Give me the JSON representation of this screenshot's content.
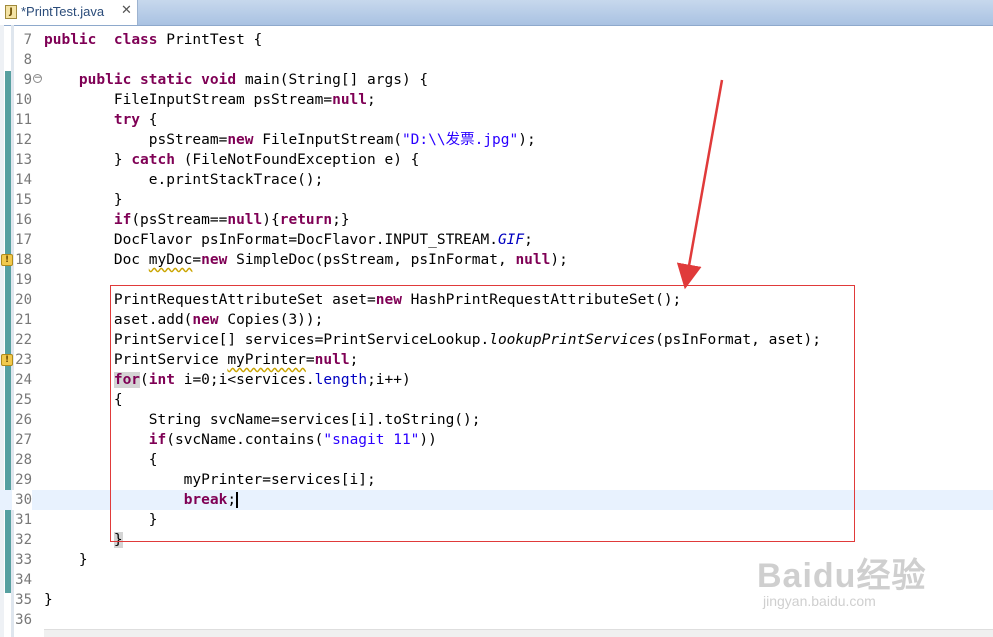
{
  "tab": {
    "title": "*PrintTest.java",
    "close": "✕",
    "icon_letter": "J"
  },
  "lines": [
    {
      "num": "7",
      "current": false,
      "fold": false,
      "warning": false,
      "segs": [
        [
          "kw",
          "public"
        ],
        [
          "",
          "  "
        ],
        [
          "kw",
          "class"
        ],
        [
          "",
          " PrintTest {"
        ]
      ]
    },
    {
      "num": "8",
      "current": false,
      "fold": false,
      "warning": false,
      "segs": []
    },
    {
      "num": "9",
      "current": false,
      "fold": true,
      "warning": false,
      "segs": [
        [
          "",
          "    "
        ],
        [
          "kw",
          "public"
        ],
        [
          "",
          " "
        ],
        [
          "kw",
          "static"
        ],
        [
          "",
          " "
        ],
        [
          "kw",
          "void"
        ],
        [
          "",
          " main(String[] args) {"
        ]
      ]
    },
    {
      "num": "10",
      "current": false,
      "fold": false,
      "warning": false,
      "segs": [
        [
          "",
          "        FileInputStream psStream="
        ],
        [
          "kw",
          "null"
        ],
        [
          "",
          ";"
        ]
      ]
    },
    {
      "num": "11",
      "current": false,
      "fold": false,
      "warning": false,
      "segs": [
        [
          "",
          "        "
        ],
        [
          "kw",
          "try"
        ],
        [
          "",
          " {"
        ]
      ]
    },
    {
      "num": "12",
      "current": false,
      "fold": false,
      "warning": false,
      "segs": [
        [
          "",
          "            psStream="
        ],
        [
          "kw",
          "new"
        ],
        [
          "",
          " FileInputStream("
        ],
        [
          "str",
          "\"D:\\\\发票.jpg\""
        ],
        [
          "",
          ");"
        ]
      ]
    },
    {
      "num": "13",
      "current": false,
      "fold": false,
      "warning": false,
      "segs": [
        [
          "",
          "        } "
        ],
        [
          "kw",
          "catch"
        ],
        [
          "",
          " (FileNotFoundException e) {"
        ]
      ]
    },
    {
      "num": "14",
      "current": false,
      "fold": false,
      "warning": false,
      "segs": [
        [
          "",
          "            e.printStackTrace();"
        ]
      ]
    },
    {
      "num": "15",
      "current": false,
      "fold": false,
      "warning": false,
      "segs": [
        [
          "",
          "        }"
        ]
      ]
    },
    {
      "num": "16",
      "current": false,
      "fold": false,
      "warning": false,
      "segs": [
        [
          "",
          "        "
        ],
        [
          "kw",
          "if"
        ],
        [
          "",
          "(psStream=="
        ],
        [
          "kw",
          "null"
        ],
        [
          "",
          "){"
        ],
        [
          "kw",
          "return"
        ],
        [
          "",
          ";}"
        ]
      ]
    },
    {
      "num": "17",
      "current": false,
      "fold": false,
      "warning": false,
      "segs": [
        [
          "",
          "        DocFlavor psInFormat=DocFlavor.INPUT_STREAM."
        ],
        [
          "fld ital",
          "GIF"
        ],
        [
          "",
          ";"
        ]
      ]
    },
    {
      "num": "18",
      "current": false,
      "fold": false,
      "warning": true,
      "segs": [
        [
          "",
          "        Doc "
        ],
        [
          "warn",
          "myDoc"
        ],
        [
          "",
          "="
        ],
        [
          "kw",
          "new"
        ],
        [
          "",
          " SimpleDoc(psStream, psInFormat, "
        ],
        [
          "kw",
          "null"
        ],
        [
          "",
          ");"
        ]
      ]
    },
    {
      "num": "19",
      "current": false,
      "fold": false,
      "warning": false,
      "segs": []
    },
    {
      "num": "20",
      "current": false,
      "fold": false,
      "warning": false,
      "segs": [
        [
          "",
          "        PrintRequestAttributeSet aset="
        ],
        [
          "kw",
          "new"
        ],
        [
          "",
          " HashPrintRequestAttributeSet();"
        ]
      ]
    },
    {
      "num": "21",
      "current": false,
      "fold": false,
      "warning": false,
      "segs": [
        [
          "",
          "        aset.add("
        ],
        [
          "kw",
          "new"
        ],
        [
          "",
          " Copies(3));"
        ]
      ]
    },
    {
      "num": "22",
      "current": false,
      "fold": false,
      "warning": false,
      "segs": [
        [
          "",
          "        PrintService[] services=PrintServiceLookup."
        ],
        [
          "ital",
          "lookupPrintServices"
        ],
        [
          "",
          "(psInFormat, aset);"
        ]
      ]
    },
    {
      "num": "23",
      "current": false,
      "fold": false,
      "warning": true,
      "segs": [
        [
          "",
          "        PrintService "
        ],
        [
          "warn",
          "myPrinter"
        ],
        [
          "",
          "="
        ],
        [
          "kw",
          "null"
        ],
        [
          "",
          ";"
        ]
      ]
    },
    {
      "num": "24",
      "current": false,
      "fold": false,
      "warning": false,
      "segs": [
        [
          "",
          "        "
        ],
        [
          "kw hl",
          "for"
        ],
        [
          "",
          "("
        ],
        [
          "kw",
          "int"
        ],
        [
          "",
          " i=0;i<services."
        ],
        [
          "fld",
          "length"
        ],
        [
          "",
          ";i++)"
        ]
      ]
    },
    {
      "num": "25",
      "current": false,
      "fold": false,
      "warning": false,
      "segs": [
        [
          "",
          "        {"
        ]
      ]
    },
    {
      "num": "26",
      "current": false,
      "fold": false,
      "warning": false,
      "segs": [
        [
          "",
          "            String svcName=services[i].toString();"
        ]
      ]
    },
    {
      "num": "27",
      "current": false,
      "fold": false,
      "warning": false,
      "segs": [
        [
          "",
          "            "
        ],
        [
          "kw",
          "if"
        ],
        [
          "",
          "(svcName.contains("
        ],
        [
          "str",
          "\"snagit 11\""
        ],
        [
          "",
          "))"
        ]
      ]
    },
    {
      "num": "28",
      "current": false,
      "fold": false,
      "warning": false,
      "segs": [
        [
          "",
          "            {"
        ]
      ]
    },
    {
      "num": "29",
      "current": false,
      "fold": false,
      "warning": false,
      "segs": [
        [
          "",
          "                myPrinter=services[i];"
        ]
      ]
    },
    {
      "num": "30",
      "current": true,
      "fold": false,
      "warning": false,
      "segs": [
        [
          "",
          "                "
        ],
        [
          "kw",
          "break"
        ],
        [
          "",
          ";"
        ]
      ],
      "cursor": true
    },
    {
      "num": "31",
      "current": false,
      "fold": false,
      "warning": false,
      "segs": [
        [
          "",
          "            }"
        ]
      ]
    },
    {
      "num": "32",
      "current": false,
      "fold": false,
      "warning": false,
      "segs": [
        [
          "",
          "        "
        ],
        [
          "hl",
          "}"
        ]
      ]
    },
    {
      "num": "33",
      "current": false,
      "fold": false,
      "warning": false,
      "segs": [
        [
          "",
          "    }"
        ]
      ]
    },
    {
      "num": "34",
      "current": false,
      "fold": false,
      "warning": false,
      "segs": []
    },
    {
      "num": "35",
      "current": false,
      "fold": false,
      "warning": false,
      "segs": [
        [
          "",
          "}"
        ]
      ]
    },
    {
      "num": "36",
      "current": false,
      "fold": false,
      "warning": false,
      "segs": []
    }
  ],
  "watermark": {
    "logo": "Baidu经验",
    "url": "jingyan.baidu.com"
  },
  "colors": {
    "keyword": "#7f0055",
    "string": "#2a00ff",
    "field": "#0000c0",
    "annotation": "#e03a3a"
  }
}
